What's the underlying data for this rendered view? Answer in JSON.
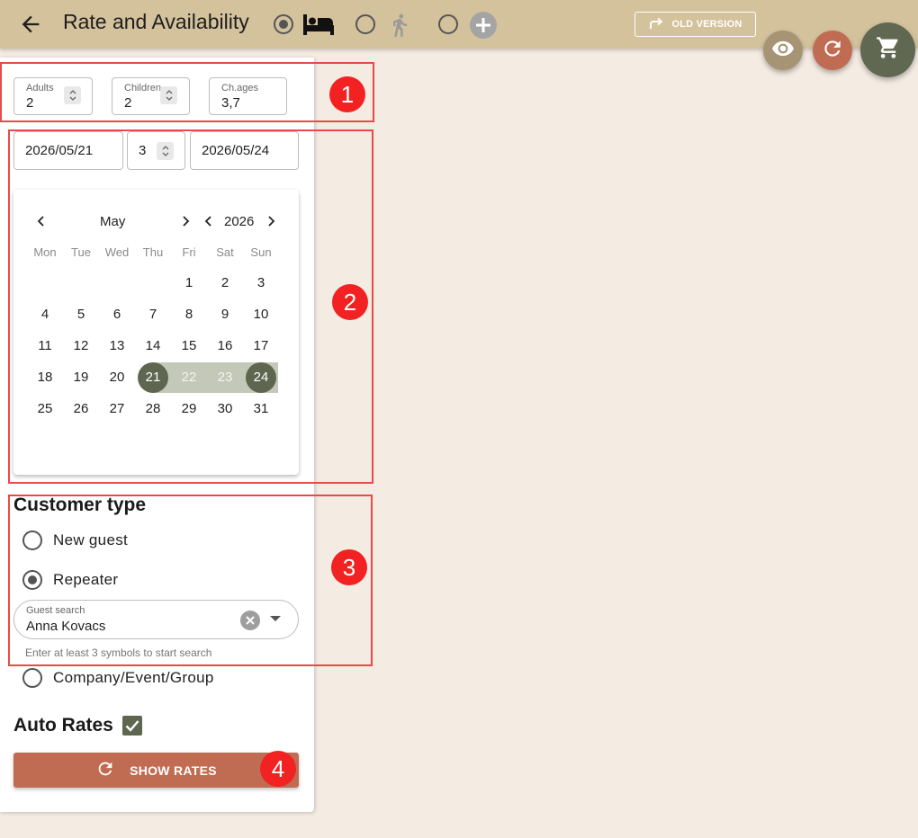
{
  "header": {
    "title": "Rate and Availability",
    "old_version_label": "OLD VERSION",
    "modes": [
      {
        "icon": "bed-icon",
        "checked": true
      },
      {
        "icon": "walking-person-icon",
        "checked": false
      },
      {
        "icon": "add-circle-icon",
        "checked": false
      }
    ],
    "colors": {
      "topbar": "#d3c29c",
      "background": "#f4ebe2"
    }
  },
  "fabs": {
    "preview": {
      "icon": "eye-icon",
      "color": "#a69474"
    },
    "refresh": {
      "icon": "refresh-icon",
      "color": "#c06c52"
    },
    "cart": {
      "icon": "cart-icon",
      "color": "#606852"
    }
  },
  "occupancy": {
    "adults": {
      "label": "Adults",
      "value": "2"
    },
    "children": {
      "label": "Children",
      "value": "2"
    },
    "child_ages": {
      "label": "Ch.ages",
      "value": "3,7"
    }
  },
  "dates": {
    "arrival": "2026/05/21",
    "nights": "3",
    "departure": "2026/05/24"
  },
  "calendar": {
    "month": "May",
    "year": "2026",
    "weekdays": [
      "Mon",
      "Tue",
      "Wed",
      "Thu",
      "Fri",
      "Sat",
      "Sun"
    ],
    "weeks": [
      [
        "",
        "",
        "",
        "",
        "1",
        "2",
        "3"
      ],
      [
        "4",
        "5",
        "6",
        "7",
        "8",
        "9",
        "10"
      ],
      [
        "11",
        "12",
        "13",
        "14",
        "15",
        "16",
        "17"
      ],
      [
        "18",
        "19",
        "20",
        "21",
        "22",
        "23",
        "24"
      ],
      [
        "25",
        "26",
        "27",
        "28",
        "29",
        "30",
        "31"
      ]
    ],
    "range_start": "21",
    "range_end": "24",
    "range_color": "#5f6650"
  },
  "customer": {
    "title": "Customer type",
    "options": [
      "New guest",
      "Repeater",
      "Company/Event/Group"
    ],
    "selected": "Repeater",
    "guest_search": {
      "label": "Guest search",
      "value": "Anna Kovacs"
    },
    "hint": "Enter at least 3 symbols to start search"
  },
  "auto_rates": {
    "label": "Auto Rates",
    "checked": true
  },
  "show_rates": {
    "label": "SHOW RATES",
    "color": "#c06c52"
  },
  "annotations": [
    "1",
    "2",
    "3",
    "4"
  ]
}
